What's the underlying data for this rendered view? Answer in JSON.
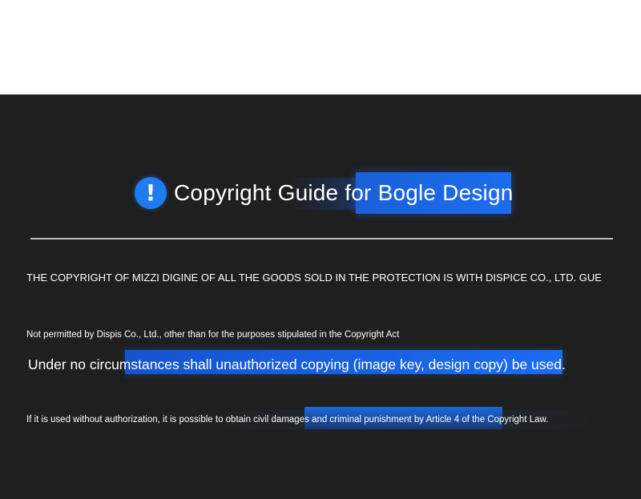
{
  "header": {
    "title": "Copyright Guide for Bogle Design",
    "icon": "exclamation-icon",
    "accent_color": "#1d6df0"
  },
  "body": {
    "line1": "THE COPYRIGHT OF MIZZI DIGINE OF ALL THE GOODS SOLD IN THE PROTECTION IS WITH DISPICE CO., LTD. GUE",
    "line2": "Not permitted by Dispis Co., Ltd., other than for the purposes stipulated in the Copyright Act",
    "line3": "Under no circumstances shall unauthorized copying (image key, design copy) be used.",
    "line4": "If it is used without authorization, it is possible to obtain civil damages and criminal punishment by Article 4 of the Copyright Law."
  }
}
